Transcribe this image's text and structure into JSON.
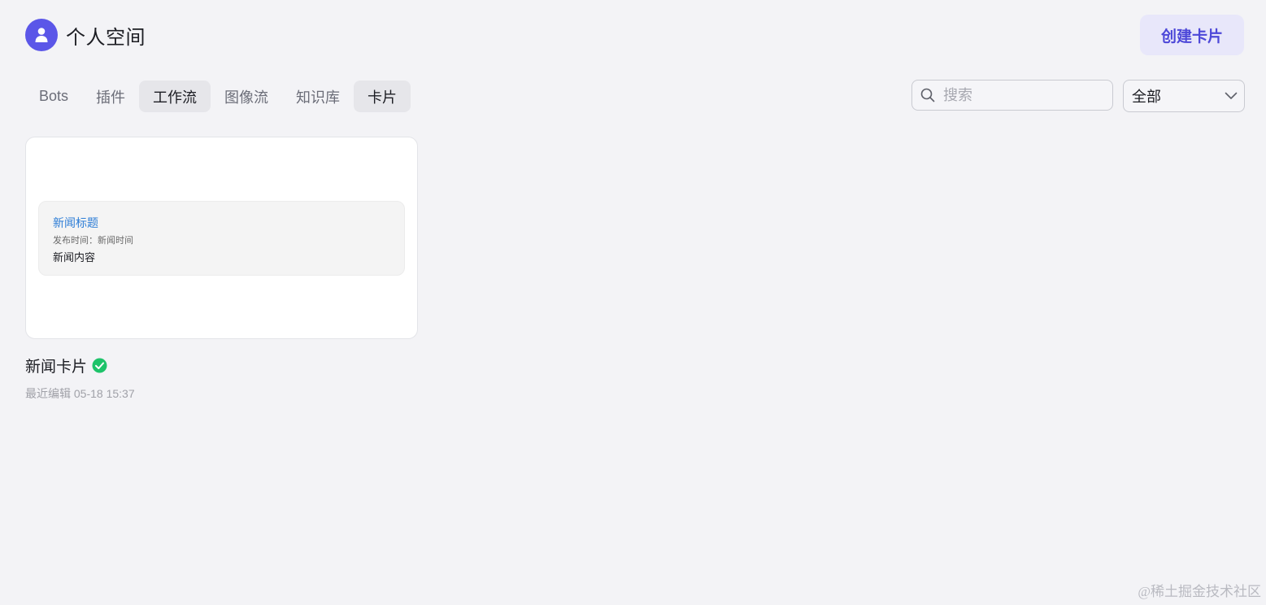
{
  "header": {
    "title": "个人空间",
    "create_button_label": "创建卡片"
  },
  "tabs": [
    {
      "label": "Bots",
      "active": false
    },
    {
      "label": "插件",
      "active": false
    },
    {
      "label": "工作流",
      "active": true
    },
    {
      "label": "图像流",
      "active": false
    },
    {
      "label": "知识库",
      "active": false
    },
    {
      "label": "卡片",
      "active": true
    }
  ],
  "search": {
    "placeholder": "搜索",
    "value": ""
  },
  "filter": {
    "selected": "全部"
  },
  "cards": [
    {
      "preview": {
        "title": "新闻标题",
        "time_line": "发布时间：新闻时间",
        "content": "新闻内容"
      },
      "name": "新闻卡片",
      "status": "published",
      "meta": "最近编辑 05-18 15:37"
    }
  ],
  "watermark": "@稀土掘金技术社区",
  "colors": {
    "accent": "#5b56e8",
    "success": "#1ec36a",
    "link": "#2d7dd6"
  }
}
